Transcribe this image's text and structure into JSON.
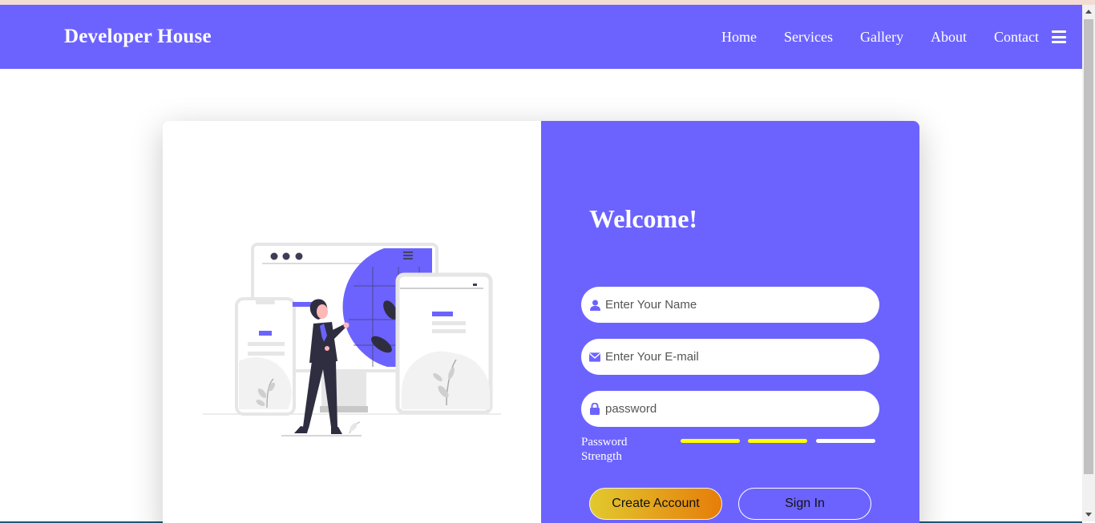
{
  "brand": "Developer House",
  "nav": {
    "links": [
      "Home",
      "Services",
      "Gallery",
      "About",
      "Contact"
    ],
    "menu_icon": "hamburger-icon"
  },
  "form": {
    "title": "Welcome!",
    "name_placeholder": "Enter Your Name",
    "email_placeholder": "Enter Your E-mail",
    "password_placeholder": "password",
    "strength_label": "Password Strength",
    "strength_segments": [
      {
        "state": "filled",
        "color": "#ffff00"
      },
      {
        "state": "filled",
        "color": "#ffff00"
      },
      {
        "state": "empty",
        "color": "#ffffff"
      }
    ],
    "create_label": "Create Account",
    "signin_label": "Sign In"
  },
  "icons": {
    "name": "user-icon",
    "email": "envelope-icon",
    "password": "lock-icon"
  },
  "colors": {
    "accent": "#6c63ff",
    "button_gradient_start": "#e2c92e",
    "button_gradient_end": "#e67d0a"
  }
}
